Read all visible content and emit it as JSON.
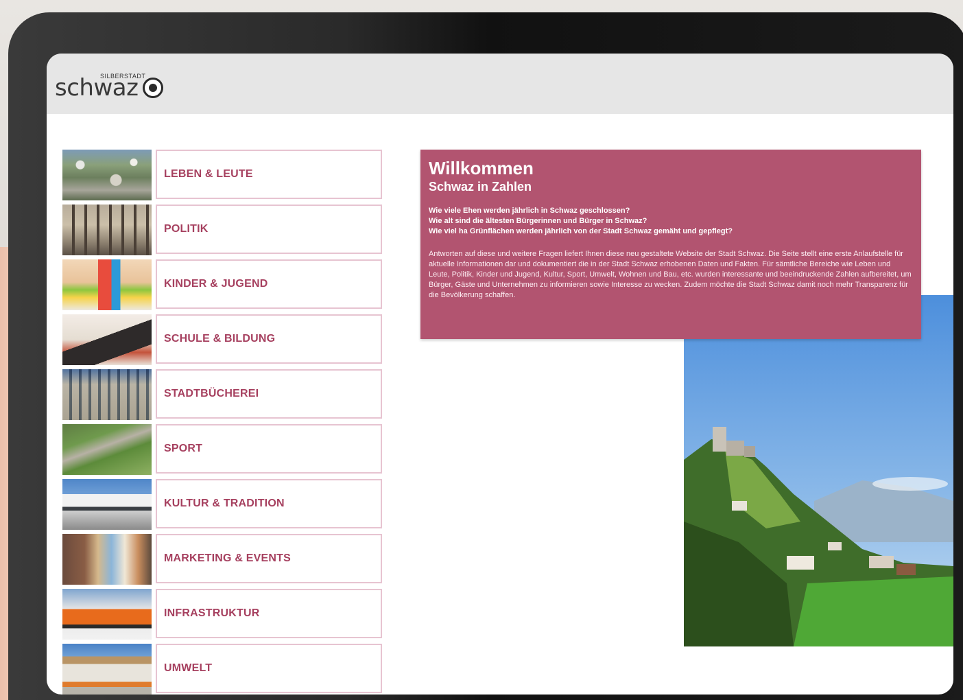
{
  "app": {
    "logo_small": "SILBERSTADT",
    "logo_word": "schwaz"
  },
  "menu": [
    {
      "label": "LEBEN & LEUTE",
      "thumb": "aerial-town-photo"
    },
    {
      "label": "POLITIK",
      "thumb": "town-hall-photo"
    },
    {
      "label": "KINDER & JUGEND",
      "thumb": "child-playing-photo"
    },
    {
      "label": "SCHULE & BILDUNG",
      "thumb": "student-desk-photo"
    },
    {
      "label": "STADTBÜCHEREI",
      "thumb": "library-building-photo"
    },
    {
      "label": "SPORT",
      "thumb": "sports-field-photo"
    },
    {
      "label": "KULTUR & TRADITION",
      "thumb": "culture-building-photo"
    },
    {
      "label": "MARKETING & EVENTS",
      "thumb": "old-town-street-photo"
    },
    {
      "label": "INFRASTRUKTUR",
      "thumb": "snow-plough-truck-photo"
    },
    {
      "label": "UMWELT",
      "thumb": "recycling-center-photo"
    }
  ],
  "welcome": {
    "title": "Willkommen",
    "subtitle": "Schwaz in Zahlen",
    "questions": [
      "Wie viele Ehen werden jährlich in Schwaz geschlossen?",
      "Wie alt sind die ältesten Bürgerinnen und Bürger in Schwaz?",
      "Wie viel ha Grünflächen werden jährlich von der Stadt Schwaz gemäht und gepflegt?"
    ],
    "body": "Antworten auf diese und weitere Fragen liefert Ihnen diese neu gestaltete Website der Stadt Schwaz. Die Seite stellt eine erste Anlaufstelle für aktuelle Informationen dar und dokumentiert die in der Stadt Schwaz erhobenen Daten und Fakten. Für sämtliche Bereiche wie Leben und Leute, Politik, Kinder und Jugend, Kultur, Sport, Umwelt, Wohnen und Bau, etc. wurden interessante und beeindruckende Zahlen aufbereitet, um Bürger, Gäste und Unternehmen zu informieren sowie Interesse zu wecken. Zudem möchte die Stadt Schwaz damit noch mehr Transparenz für die Bevölkerung schaffen."
  },
  "colors": {
    "accent": "#b25470",
    "menu_text": "#a6405f",
    "menu_border": "#e7c4d1",
    "header_bg": "#e6e6e6"
  }
}
